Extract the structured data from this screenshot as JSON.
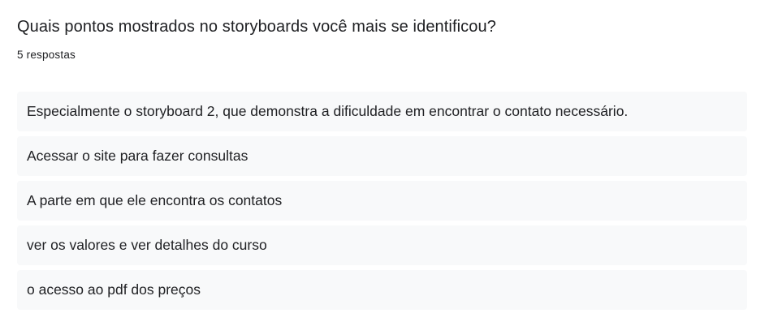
{
  "question": {
    "title": "Quais pontos mostrados no storyboards você mais se identificou?",
    "response_count": "5 respostas"
  },
  "responses": [
    "Especialmente o storyboard 2, que demonstra a dificuldade em encontrar o contato necessário.",
    "Acessar o site para fazer consultas",
    "A parte em que ele encontra os contatos",
    "ver os valores e ver detalhes do curso",
    "o acesso ao pdf dos preços"
  ],
  "colors": {
    "text": "#202124",
    "response_background": "#f8f9fa",
    "page_background": "#ffffff"
  }
}
